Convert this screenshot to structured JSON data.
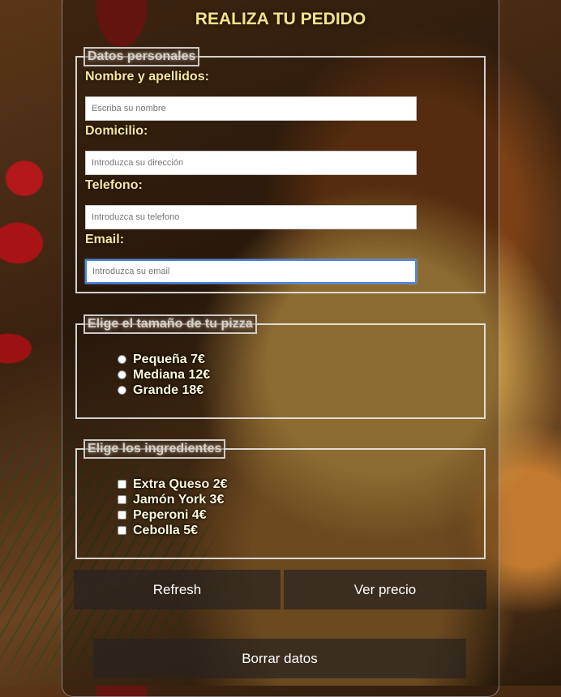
{
  "form": {
    "title": "REALIZA TU PEDIDO",
    "personal": {
      "legend": "Datos personales",
      "fields": [
        {
          "label": "Nombre y apellidos:",
          "placeholder": "Escriba su nombre",
          "value": ""
        },
        {
          "label": "Domicilio:",
          "placeholder": "Introduzca su dirección",
          "value": ""
        },
        {
          "label": "Telefono:",
          "placeholder": "Introduzca su telefono",
          "value": ""
        },
        {
          "label": "Email:",
          "placeholder": "Introduzca su email",
          "value": "",
          "focused": true
        }
      ]
    },
    "size": {
      "legend": "Elige el tamaño de tu pizza",
      "options": [
        "Pequeña 7€",
        "Mediana 12€",
        "Grande 18€"
      ],
      "selected": null
    },
    "ingredients": {
      "legend": "Elige los ingredientes",
      "options": [
        "Extra Queso 2€",
        "Jamón York 3€",
        "Peperoni 4€",
        "Cebolla 5€"
      ],
      "checked": []
    },
    "buttons": {
      "refresh": "Refresh",
      "ver_precio": "Ver precio",
      "borrar": "Borrar datos"
    }
  },
  "colors": {
    "title": "#f3e48a",
    "label": "#f5e6a0",
    "focus_border": "#4a86e8"
  }
}
